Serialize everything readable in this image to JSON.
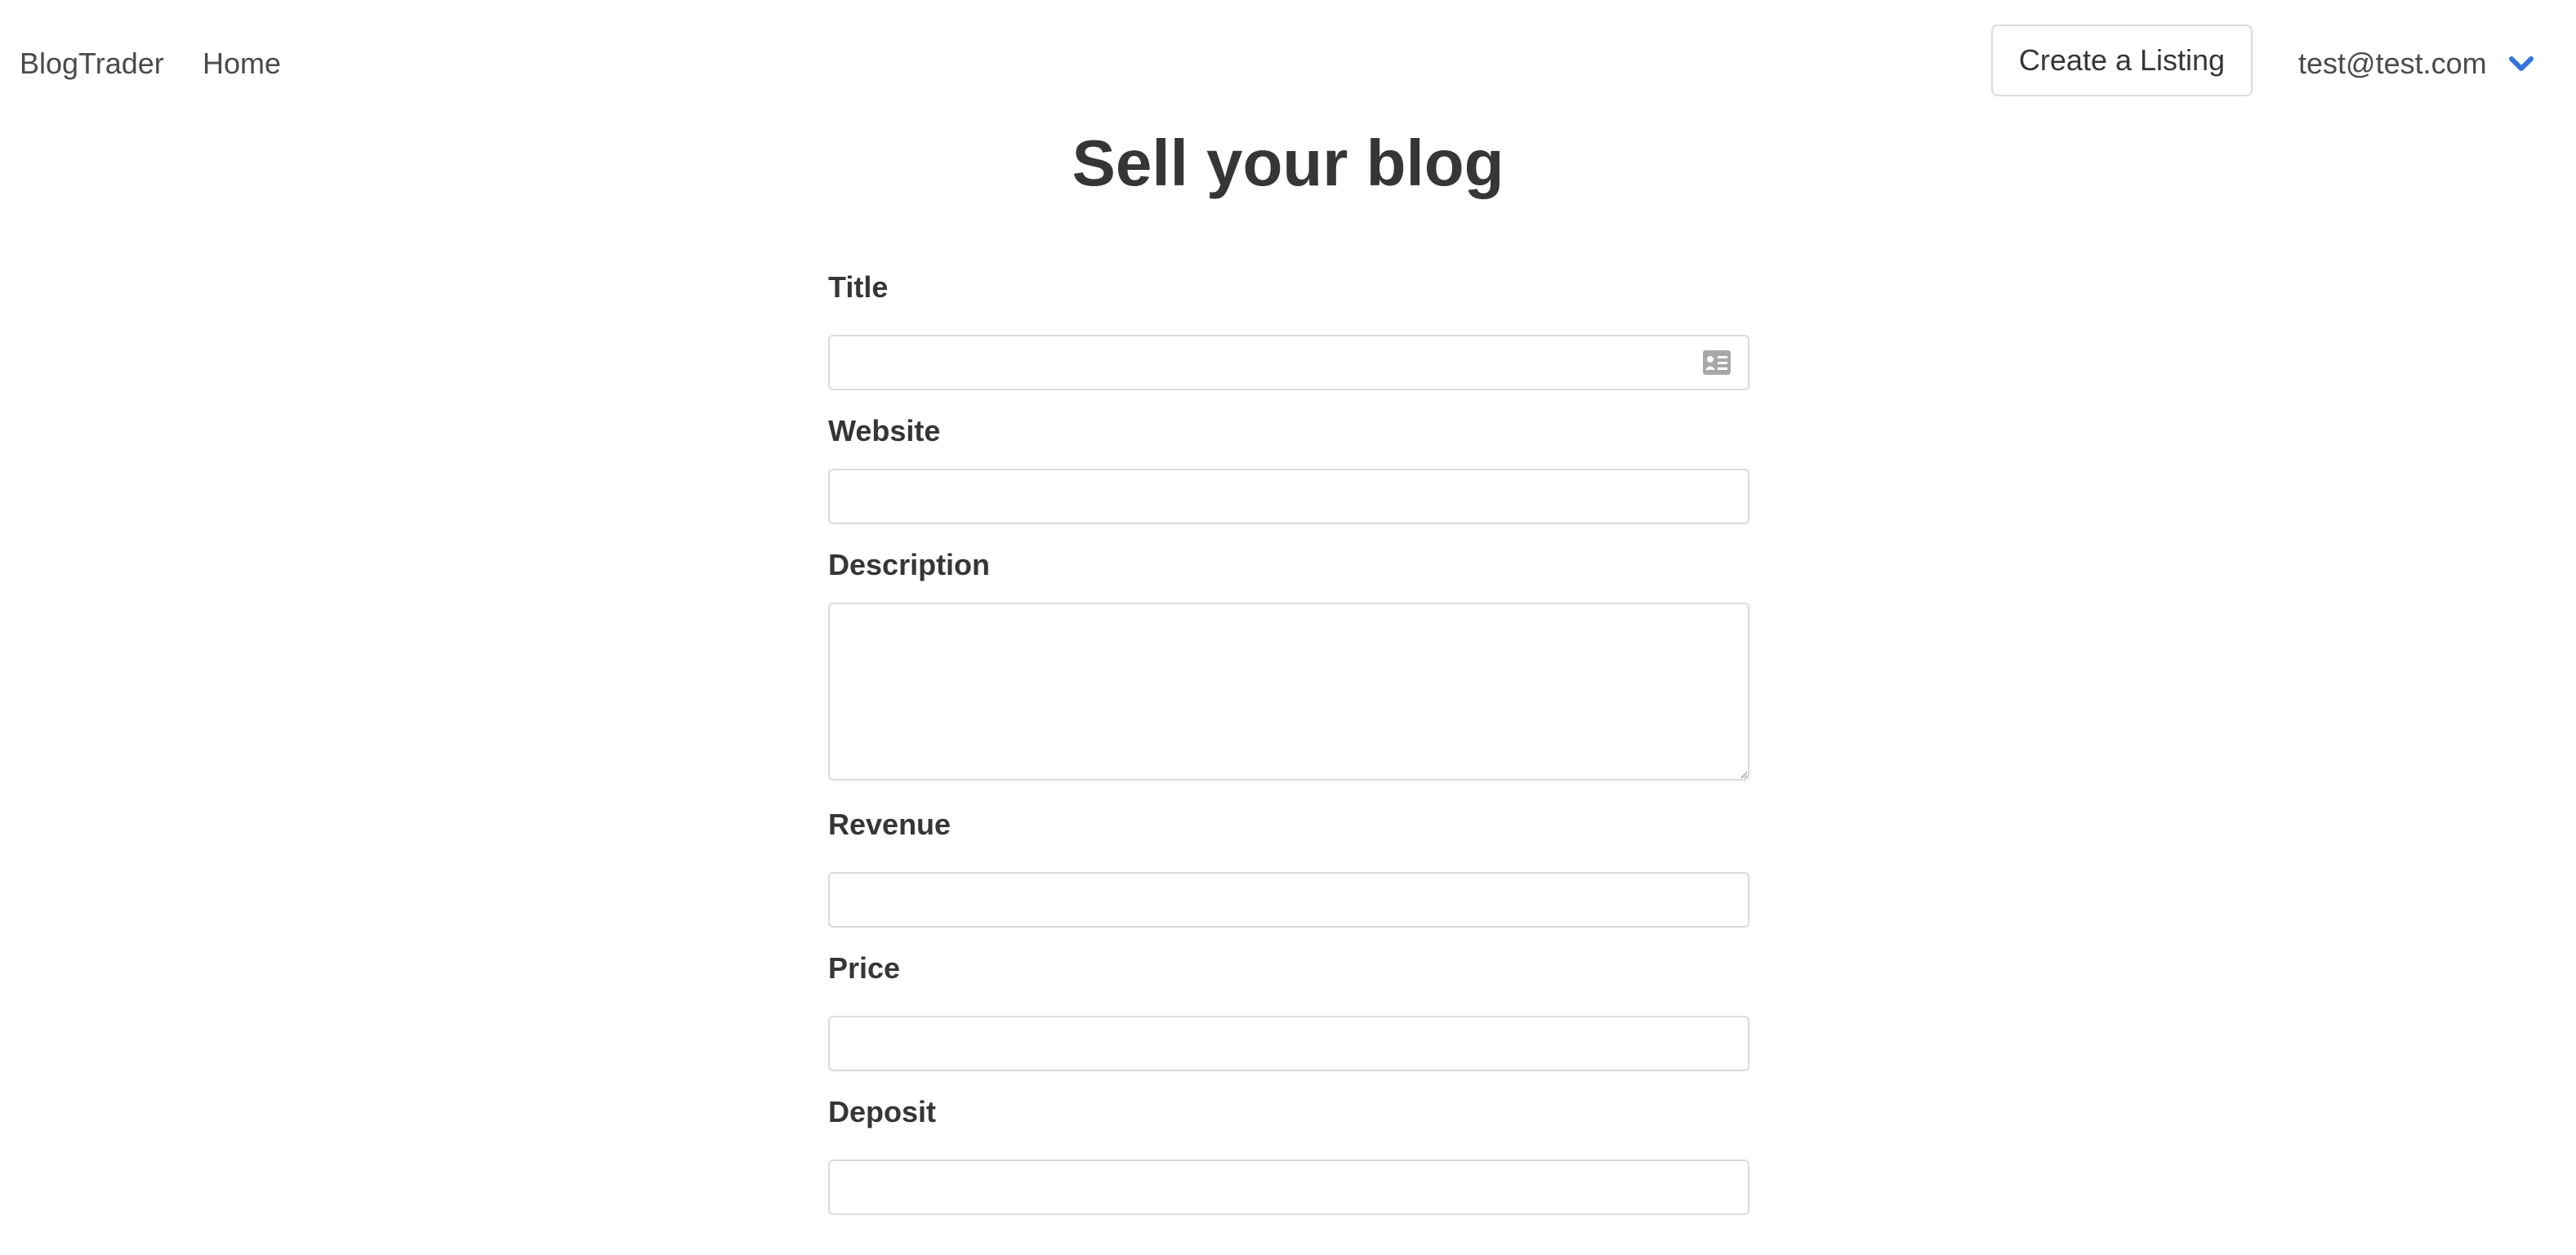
{
  "nav": {
    "brand": "BlogTrader",
    "home": "Home",
    "create_listing": "Create a Listing",
    "user_email": "test@test.com",
    "user_chevron_icon": "chevron-down-icon"
  },
  "page": {
    "title": "Sell your blog"
  },
  "form": {
    "title_label": "Title",
    "title_value": "",
    "title_autofill_icon": "contact-card-icon",
    "website_label": "Website",
    "website_value": "",
    "description_label": "Description",
    "description_value": "",
    "revenue_label": "Revenue",
    "revenue_value": "",
    "price_label": "Price",
    "price_value": "",
    "deposit_label": "Deposit",
    "deposit_value": ""
  },
  "colors": {
    "accent": "#3273dc",
    "border": "#dbdbdb",
    "text": "#363636"
  }
}
